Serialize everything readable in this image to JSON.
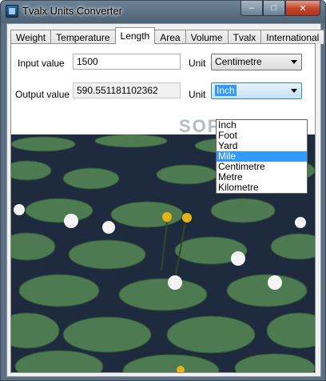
{
  "window": {
    "title": "Tvalx Units Converter",
    "minimize": "–",
    "maximize": "□",
    "close": "✕"
  },
  "tabs": [
    "Weight",
    "Temperature",
    "Length",
    "Area",
    "Volume",
    "Tvalx",
    "International"
  ],
  "active_tab": "Length",
  "input": {
    "label": "Input value",
    "value": "1500",
    "unit_label": "Unit",
    "unit_value": "Centimetre"
  },
  "output": {
    "label": "Output value",
    "value": "590.551181102362",
    "unit_label": "Unit",
    "unit_value": "Inch"
  },
  "dropdown": {
    "options": [
      "Inch",
      "Foot",
      "Yard",
      "Mile",
      "Centimetre",
      "Metre",
      "Kilometre"
    ],
    "highlighted": "Mile"
  },
  "watermark": "SOFTPEDIA",
  "colors": {
    "selection": "#3399ff",
    "water": "#1e2a3e",
    "pad": "#4e7a52"
  }
}
